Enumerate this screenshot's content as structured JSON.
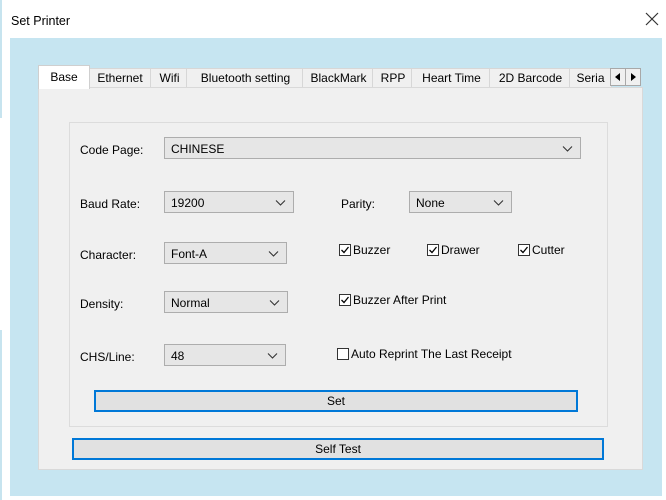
{
  "window": {
    "title": "Set Printer"
  },
  "tabs": [
    {
      "label": "Base"
    },
    {
      "label": "Ethernet"
    },
    {
      "label": "Wifi"
    },
    {
      "label": "Bluetooth setting"
    },
    {
      "label": "BlackMark"
    },
    {
      "label": "RPP"
    },
    {
      "label": "Heart Time"
    },
    {
      "label": "2D Barcode"
    },
    {
      "label": "Seria"
    }
  ],
  "fields": {
    "code_page": {
      "label": "Code Page:",
      "value": "CHINESE"
    },
    "baud_rate": {
      "label": "Baud Rate:",
      "value": "19200"
    },
    "parity": {
      "label": "Parity:",
      "value": "None"
    },
    "character": {
      "label": "Character:",
      "value": "Font-A"
    },
    "density": {
      "label": "Density:",
      "value": "Normal"
    },
    "chs_line": {
      "label": "CHS/Line:",
      "value": "48"
    }
  },
  "checkboxes": {
    "buzzer": {
      "label": "Buzzer",
      "checked": true
    },
    "drawer": {
      "label": "Drawer",
      "checked": true
    },
    "cutter": {
      "label": "Cutter",
      "checked": true
    },
    "buzzer_after_print": {
      "label": "Buzzer After Print",
      "checked": true
    },
    "auto_reprint": {
      "label": "Auto Reprint The Last Receipt",
      "checked": false
    }
  },
  "buttons": {
    "set": "Set",
    "self_test": "Self Test"
  },
  "icons": {
    "close": "close-icon",
    "scroll_left": "arrow-left-icon",
    "scroll_right": "arrow-right-icon",
    "dropdown": "chevron-down-icon",
    "check": "checkmark-icon"
  },
  "colors": {
    "client_bg": "#c6e5f1",
    "focus_border": "#0078d7"
  }
}
